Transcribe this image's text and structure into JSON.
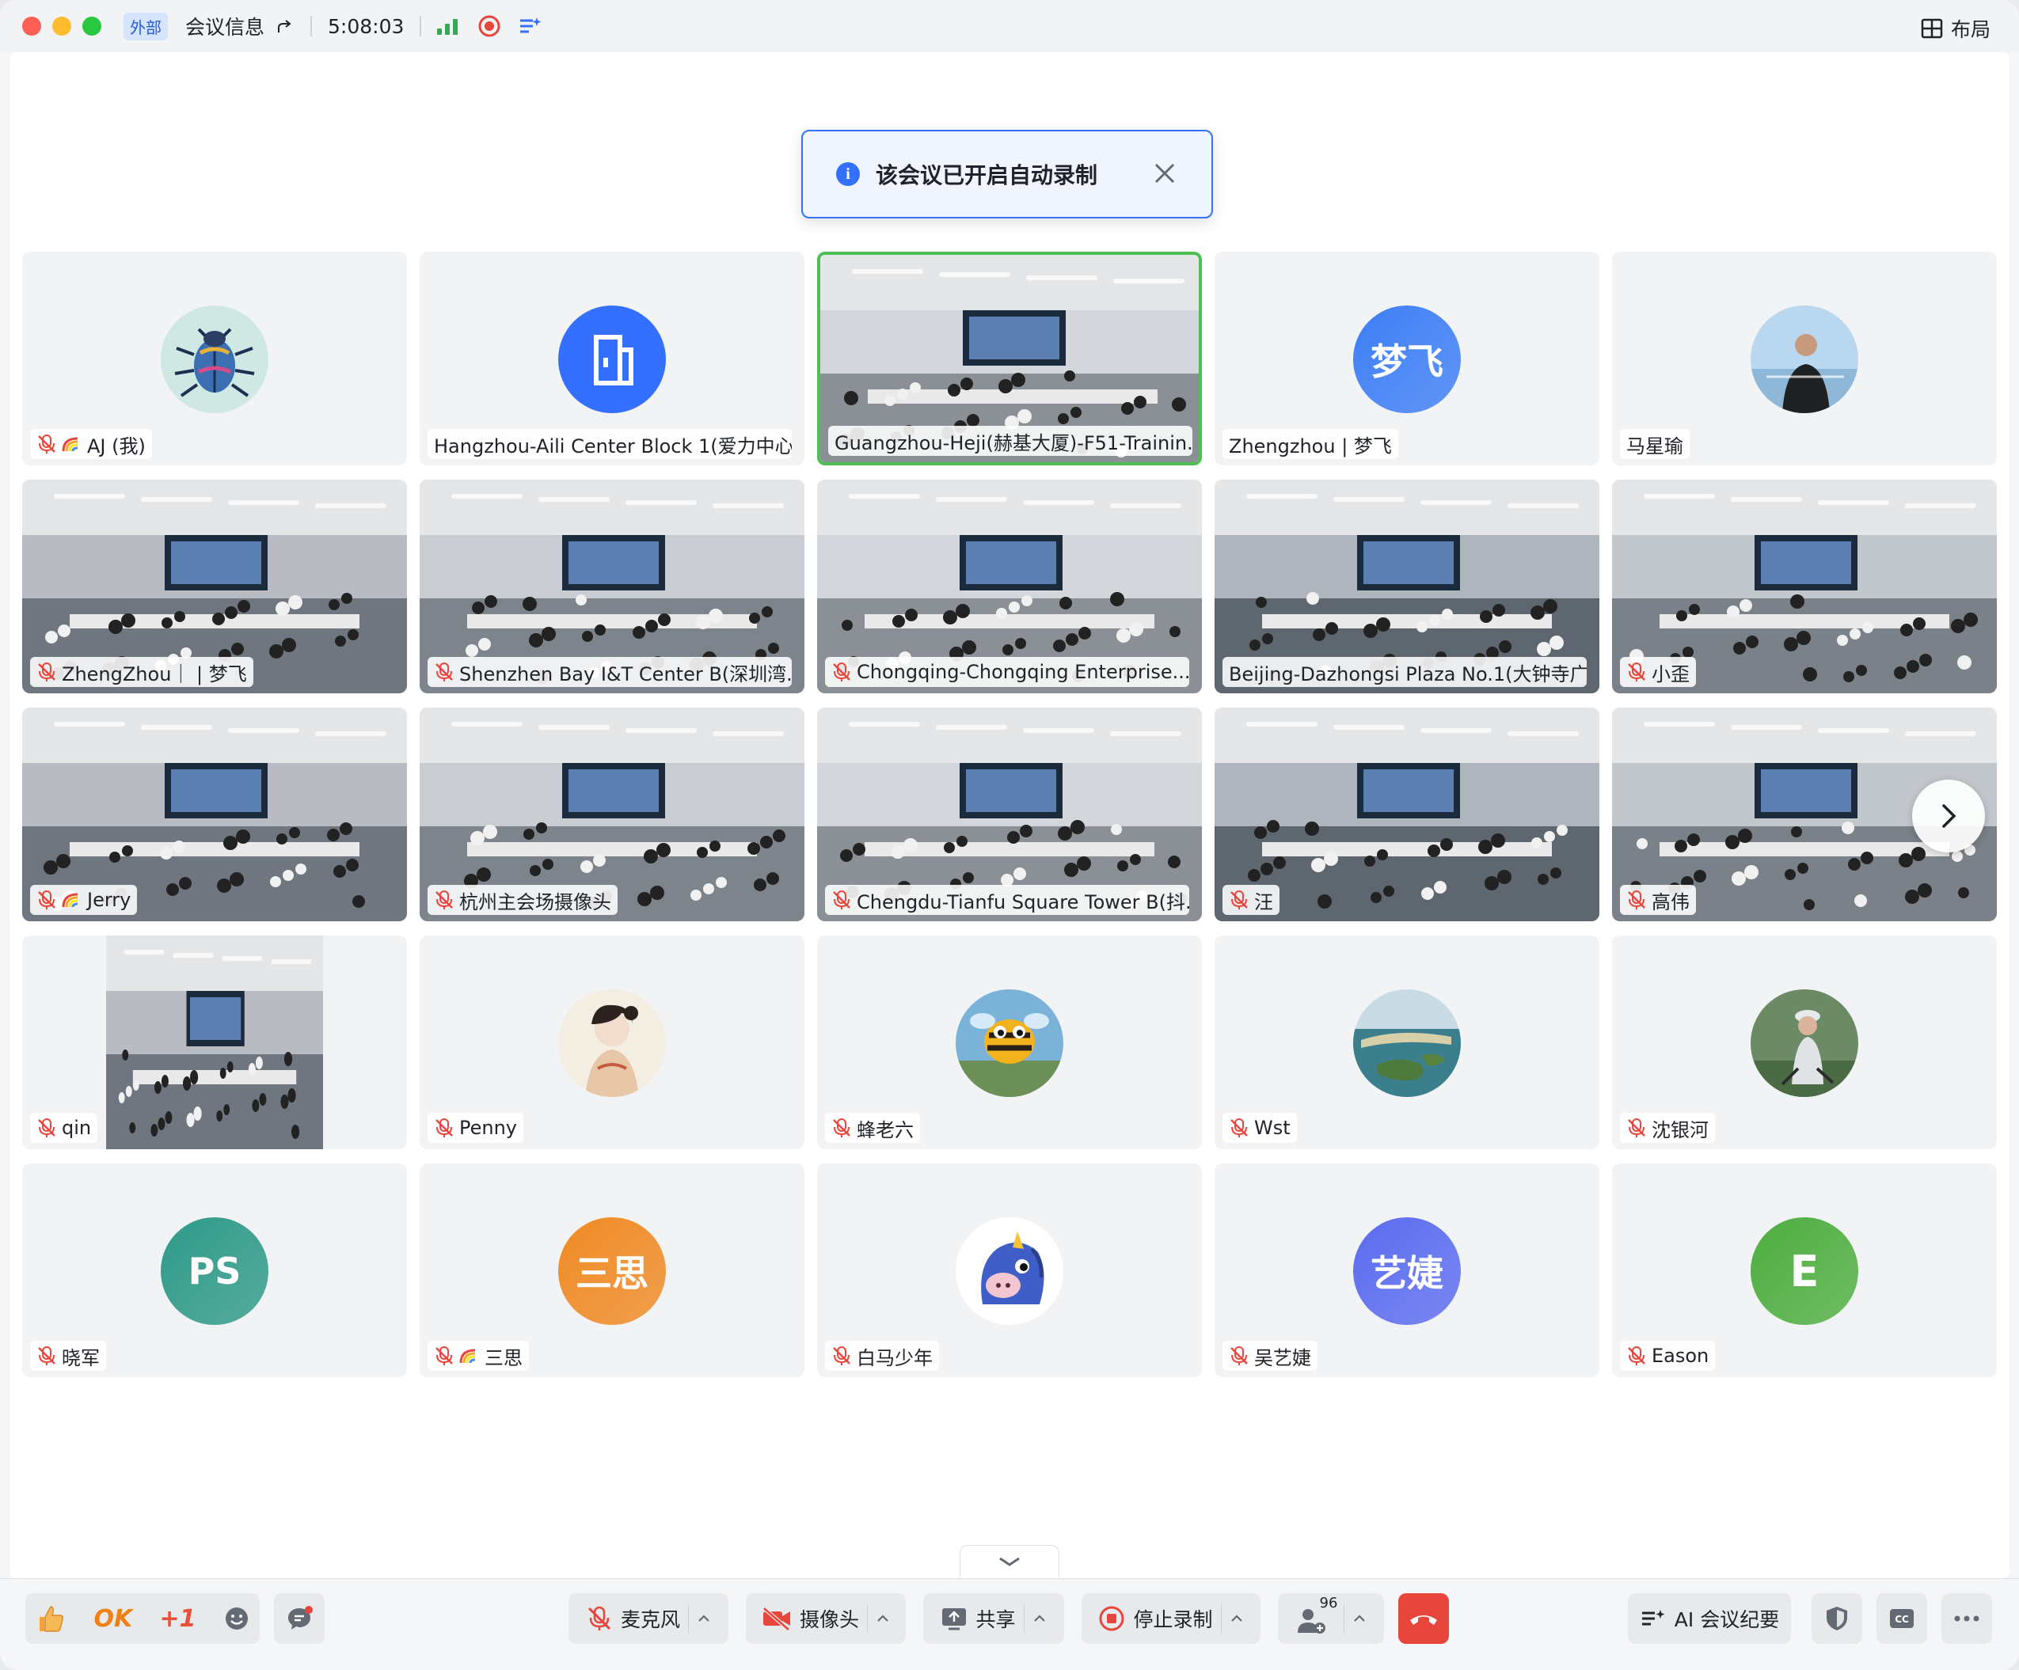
{
  "titlebar": {
    "tag": "外部",
    "meeting_info": "会议信息",
    "timer": "5:08:03",
    "layout_label": "布局"
  },
  "toast": {
    "message": "该会议已开启自动录制"
  },
  "participants": [
    {
      "name": "AJ (我)",
      "muted": true,
      "rainbow": true,
      "kind": "avatar",
      "avatar": "beetle"
    },
    {
      "name": "Hangzhou-Aili Center Block 1(爱力中心...",
      "muted": false,
      "kind": "avatar",
      "avatar": "room",
      "color": "#3370ff"
    },
    {
      "name": "Guangzhou-Heji(赫基大厦)-F51-Trainin...",
      "muted": false,
      "kind": "video",
      "active": true
    },
    {
      "name": "Zhengzhou | 梦飞",
      "muted": false,
      "kind": "avatar",
      "initials": "梦飞",
      "color": "#3d7ef6"
    },
    {
      "name": "马星瑜",
      "muted": false,
      "kind": "avatar",
      "avatar": "photo-man"
    },
    {
      "name": "ZhengZhou｜ | 梦飞",
      "muted": true,
      "kind": "video"
    },
    {
      "name": "Shenzhen Bay I&T Center B(深圳湾...",
      "muted": true,
      "kind": "video"
    },
    {
      "name": "Chongqing-Chongqing Enterprise...",
      "muted": true,
      "kind": "video"
    },
    {
      "name": "Beijing-Dazhongsi Plaza No.1(大钟寺广...",
      "muted": false,
      "kind": "video"
    },
    {
      "name": "小歪",
      "muted": true,
      "kind": "video"
    },
    {
      "name": "Jerry",
      "muted": true,
      "rainbow": true,
      "kind": "video"
    },
    {
      "name": "杭州主会场摄像头",
      "muted": true,
      "kind": "video"
    },
    {
      "name": "Chengdu-Tianfu Square Tower B(抖...",
      "muted": true,
      "kind": "video"
    },
    {
      "name": "汪",
      "muted": true,
      "kind": "video"
    },
    {
      "name": "高伟",
      "muted": true,
      "kind": "video"
    },
    {
      "name": "qin",
      "muted": true,
      "kind": "video-narrow"
    },
    {
      "name": "Penny",
      "muted": true,
      "kind": "avatar",
      "avatar": "painting"
    },
    {
      "name": "蜂老六",
      "muted": true,
      "kind": "avatar",
      "avatar": "bee"
    },
    {
      "name": "Wst",
      "muted": true,
      "kind": "avatar",
      "avatar": "island"
    },
    {
      "name": "沈银河",
      "muted": true,
      "kind": "avatar",
      "avatar": "photo-woman"
    },
    {
      "name": "晓军",
      "muted": true,
      "kind": "avatar",
      "initials": "PS",
      "color": "#2e9a88"
    },
    {
      "name": "三思",
      "muted": true,
      "rainbow": true,
      "kind": "avatar",
      "initials": "三思",
      "color": "#f08a24"
    },
    {
      "name": "白马少年",
      "muted": true,
      "kind": "avatar",
      "avatar": "unicorn"
    },
    {
      "name": "吴艺婕",
      "muted": true,
      "kind": "avatar",
      "initials": "艺婕",
      "color": "#5b6cf0"
    },
    {
      "name": "Eason",
      "muted": true,
      "kind": "avatar",
      "initials": "E",
      "color": "#4eae3f"
    }
  ],
  "toolbar": {
    "reaction_ok": "OK",
    "reaction_plus1": "+1",
    "mic_label": "麦克风",
    "camera_label": "摄像头",
    "share_label": "共享",
    "stop_record_label": "停止录制",
    "participants_count": "96",
    "ai_notes_label": "AI 会议纪要"
  },
  "colors": {
    "accent": "#3370ff",
    "active_speaker": "#4cc053",
    "hangup": "#e8463c",
    "mute": "#e8463c"
  }
}
